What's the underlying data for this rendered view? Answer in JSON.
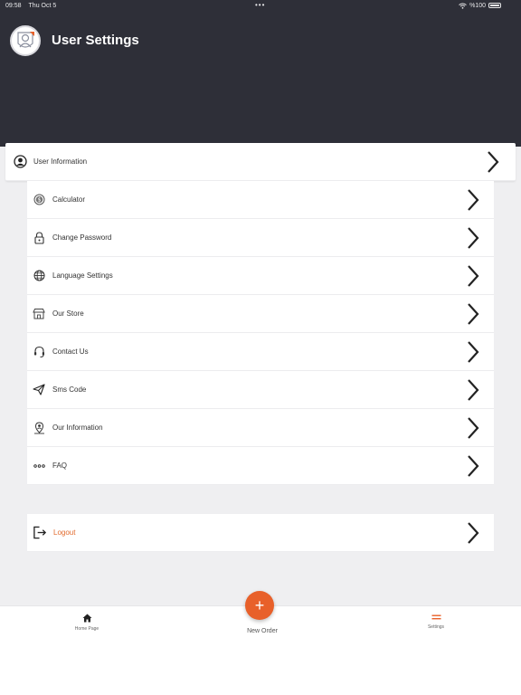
{
  "status_bar": {
    "time": "09:58",
    "date": "Thu Oct 5",
    "battery": "%100"
  },
  "header": {
    "title": "User Settings"
  },
  "menu": {
    "user_information": "User Information",
    "items": [
      {
        "label": "Calculator",
        "icon": "dollar-coin-icon"
      },
      {
        "label": "Change Password",
        "icon": "lock-icon"
      },
      {
        "label": "Language Settings",
        "icon": "globe-icon"
      },
      {
        "label": "Our Store",
        "icon": "store-icon"
      },
      {
        "label": "Contact Us",
        "icon": "headset-icon"
      },
      {
        "label": "Sms Code",
        "icon": "paper-plane-icon"
      },
      {
        "label": "Our Information",
        "icon": "map-pin-user-icon"
      },
      {
        "label": "FAQ",
        "icon": "ellipsis-icon"
      }
    ],
    "logout": "Logout"
  },
  "tabbar": {
    "home": "Home Page",
    "new_order": "New Order",
    "settings": "Settings"
  },
  "colors": {
    "header_bg": "#2e2f38",
    "accent": "#e8602a",
    "logout_text": "#e26a2c"
  }
}
